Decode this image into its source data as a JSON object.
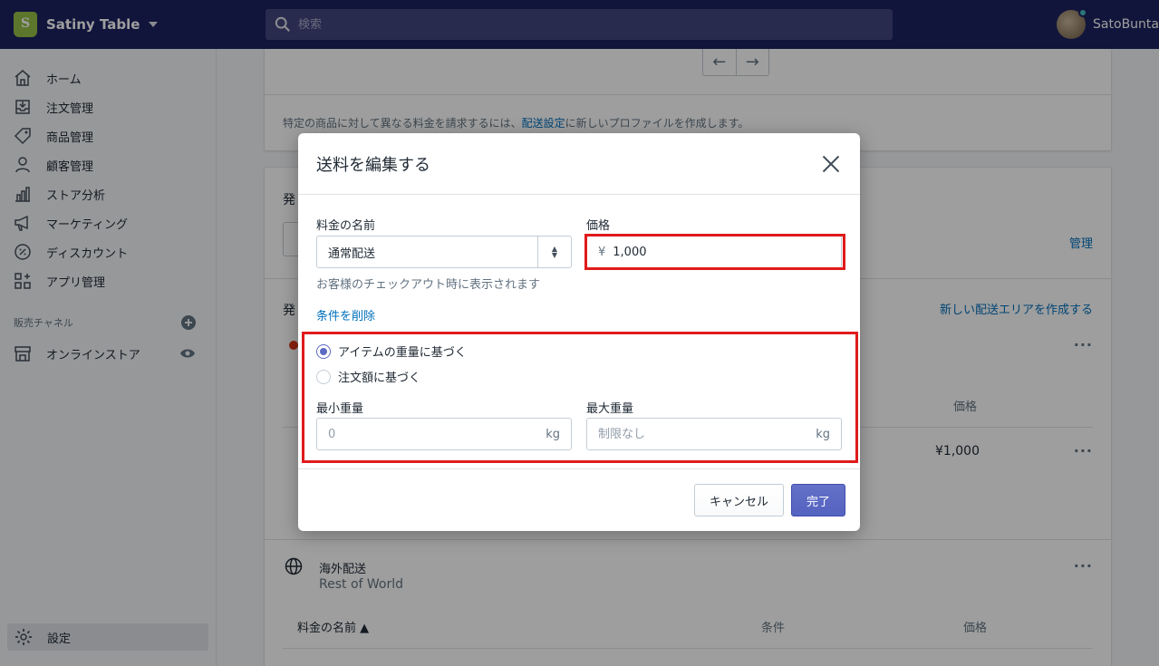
{
  "topbar": {
    "store_name": "Satiny Table",
    "search_placeholder": "検索",
    "user_name": "SatoBunta"
  },
  "sidebar": {
    "items": [
      {
        "label": "ホーム",
        "icon": "home-icon"
      },
      {
        "label": "注文管理",
        "icon": "orders-icon"
      },
      {
        "label": "商品管理",
        "icon": "tag-icon"
      },
      {
        "label": "顧客管理",
        "icon": "person-icon"
      },
      {
        "label": "ストア分析",
        "icon": "bar-chart-icon"
      },
      {
        "label": "マーケティング",
        "icon": "megaphone-icon"
      },
      {
        "label": "ディスカウント",
        "icon": "discount-icon"
      },
      {
        "label": "アプリ管理",
        "icon": "apps-icon"
      }
    ],
    "channels_title": "販売チャネル",
    "online_store": "オンラインストア",
    "settings": "設定"
  },
  "background": {
    "note_prefix": "特定の商品に対して異なる料金を請求するには、",
    "note_link": "配送設定",
    "note_suffix": "に新しいプロファイルを作成します。",
    "section1_partial": "発",
    "manage_link": "管理",
    "section2_partial": "発",
    "new_zone_link": "新しい配送エリアを作成する",
    "price_header": "価格",
    "price_value": "¥1,000",
    "zone_name": "海外配送",
    "zone_sub": "Rest of World",
    "col_name": "料金の名前",
    "col_condition": "条件",
    "col_price": "価格"
  },
  "modal": {
    "title": "送料を編集する",
    "rate_name_label": "料金の名前",
    "rate_name_value": "通常配送",
    "rate_name_help": "お客様のチェックアウト時に表示されます",
    "price_label": "価格",
    "currency": "¥",
    "price_value": "1,000",
    "remove_conditions": "条件を削除",
    "radio_weight": "アイテムの重量に基づく",
    "radio_order": "注文額に基づく",
    "min_weight_label": "最小重量",
    "min_weight_placeholder": "0",
    "max_weight_label": "最大重量",
    "max_weight_placeholder": "制限なし",
    "unit": "kg",
    "cancel": "キャンセル",
    "done": "完了"
  }
}
